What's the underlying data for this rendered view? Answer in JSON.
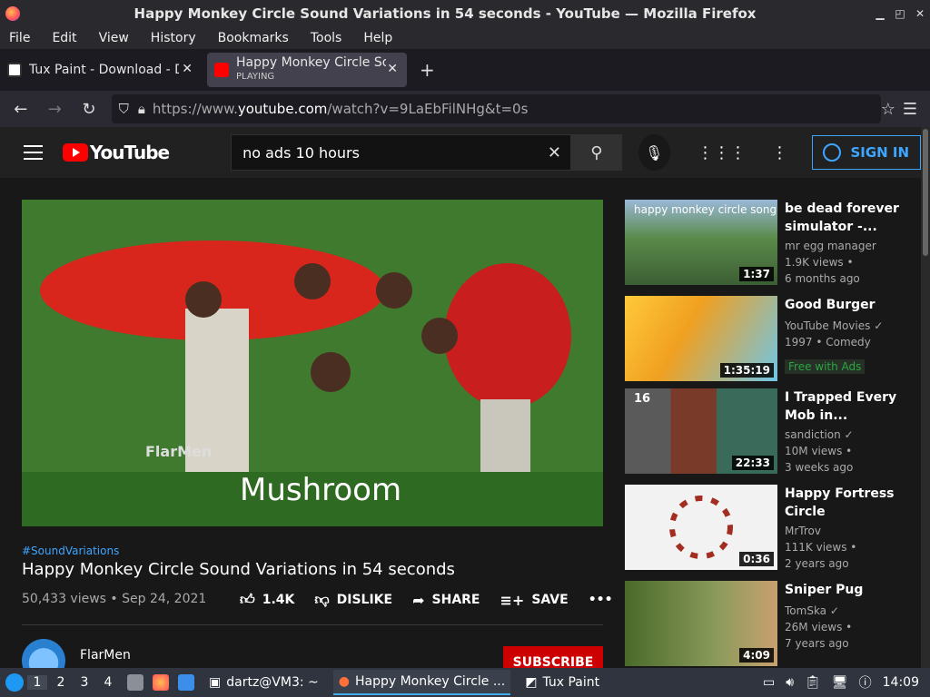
{
  "window": {
    "title": "Happy Monkey Circle Sound Variations in 54 seconds - YouTube — Mozilla Firefox"
  },
  "menu": [
    "File",
    "Edit",
    "View",
    "History",
    "Bookmarks",
    "Tools",
    "Help"
  ],
  "tabs": [
    {
      "label": "Tux Paint - Download - De"
    },
    {
      "label": "Happy Monkey Circle Sou",
      "status": "PLAYING"
    }
  ],
  "url": {
    "prefix": "https://www.",
    "domain": "youtube.com",
    "path": "/watch?v=9LaEbFilNHg&t=0s"
  },
  "yt": {
    "brand": "YouTube",
    "search_value": "no ads 10 hours",
    "signin": "SIGN IN"
  },
  "video": {
    "caption_brand": "FlarMen",
    "caption_word": "Mushroom",
    "hashtag": "#SoundVariations",
    "title": "Happy Monkey Circle Sound Variations in 54 seconds",
    "meta": "50,433 views • Sep 24, 2021",
    "likes": "1.4K",
    "dislike": "DISLIKE",
    "share": "SHARE",
    "save": "SAVE",
    "channel": "FlarMen",
    "subscribe": "SUBSCRIBE"
  },
  "recommendations": [
    {
      "thumb_text": "happy monkey circle song",
      "duration": "1:37",
      "title": "be dead forever simulator -...",
      "channel": "mr egg manager",
      "line1": "1.9K views •",
      "line2": "6 months ago"
    },
    {
      "thumb_text": "",
      "duration": "1:35:19",
      "title": "Good Burger",
      "channel": "YouTube Movies ✓",
      "line1": "1997 • Comedy",
      "line2": "",
      "badge": "Free with Ads"
    },
    {
      "thumb_text": "16",
      "duration": "22:33",
      "title": "I Trapped Every Mob in...",
      "channel": "sandiction ✓",
      "line1": "10M views •",
      "line2": "3 weeks ago"
    },
    {
      "thumb_text": "",
      "duration": "0:36",
      "title": "Happy Fortress Circle",
      "channel": "MrTrov",
      "line1": "111K views •",
      "line2": "2 years ago"
    },
    {
      "thumb_text": "",
      "duration": "4:09",
      "title": "Sniper Pug",
      "channel": "TomSka ✓",
      "line1": "26M views •",
      "line2": "7 years ago"
    }
  ],
  "taskbar": {
    "workspaces": [
      "1",
      "2",
      "3",
      "4"
    ],
    "tasks": [
      "dartz@VM3: ~",
      "Happy Monkey Circle ...",
      "Tux Paint"
    ],
    "clock": "14:09"
  }
}
